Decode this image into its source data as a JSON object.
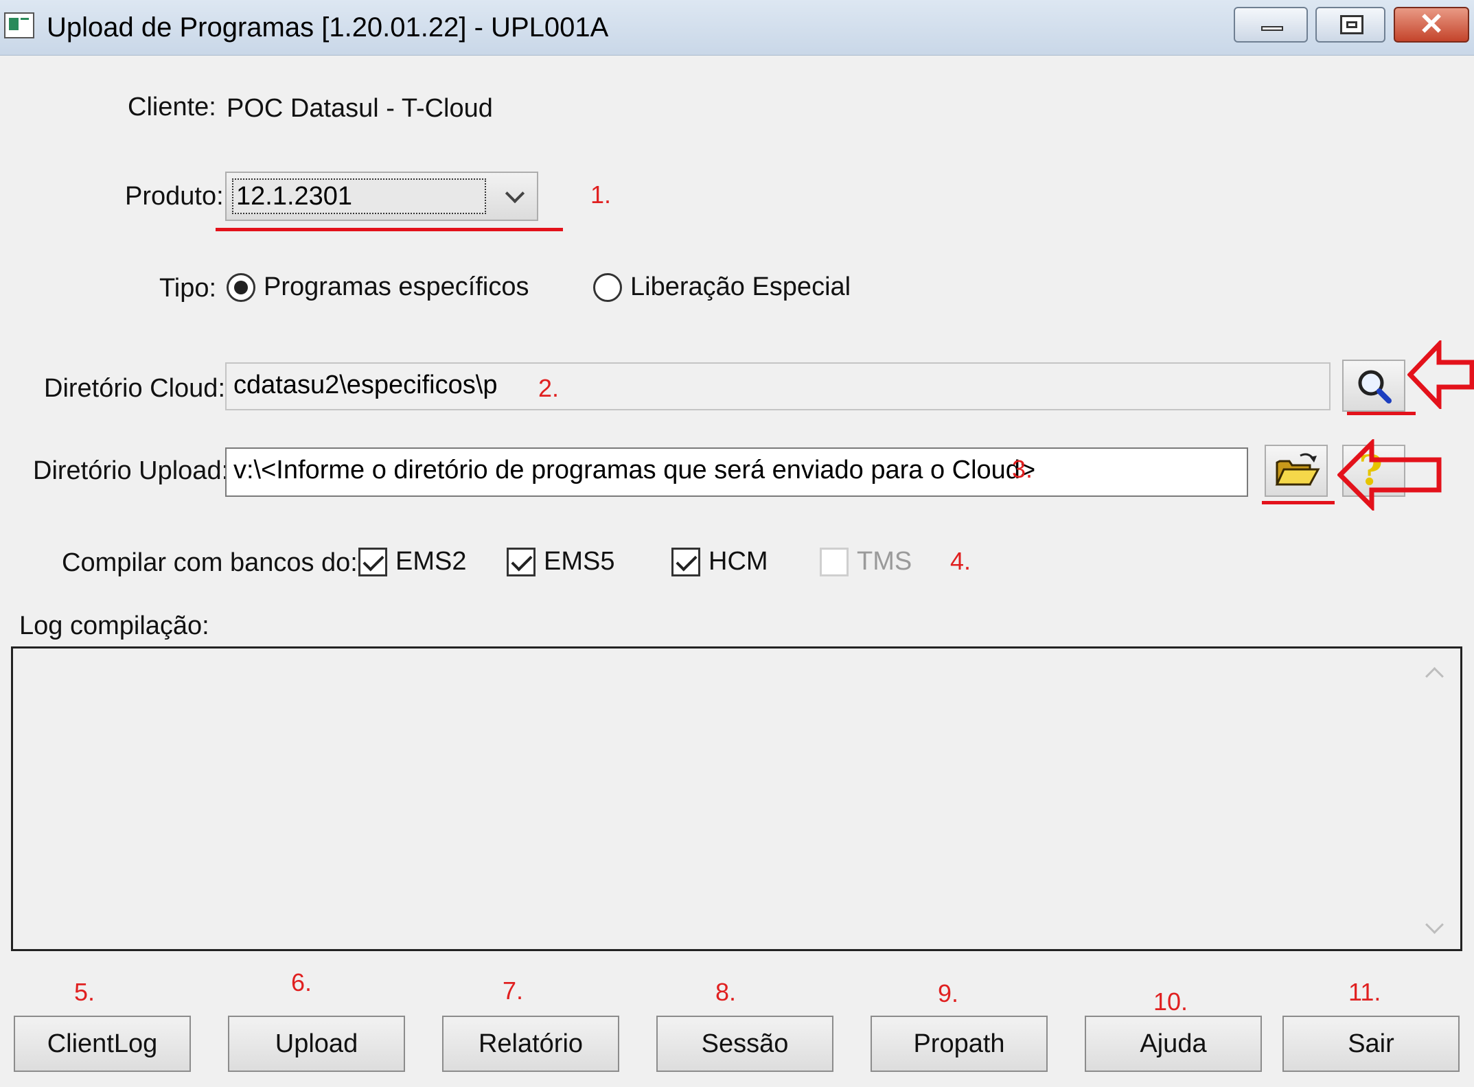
{
  "window": {
    "title": "Upload de Programas [1.20.01.22] - UPL001A",
    "close_glyph": "✕"
  },
  "cliente": {
    "label": "Cliente:",
    "value": "POC Datasul - T-Cloud"
  },
  "produto": {
    "label": "Produto:",
    "value": "12.1.2301",
    "marker": "1."
  },
  "tipo": {
    "label": "Tipo:",
    "options": [
      {
        "label": "Programas específicos",
        "selected": true
      },
      {
        "label": "Liberação Especial",
        "selected": false
      }
    ]
  },
  "diretorio_cloud": {
    "label": "Diretório Cloud:",
    "value": "cdatasu2\\especificos\\p",
    "marker": "2."
  },
  "diretorio_upload": {
    "label": "Diretório Upload:",
    "value": "v:\\<Informe o diretório de programas que será enviado para o Cloud>",
    "marker": "3.",
    "help_glyph": "?"
  },
  "compilar": {
    "label": "Compilar com bancos do:",
    "marker": "4.",
    "options": [
      {
        "label": "EMS2",
        "checked": true,
        "enabled": true
      },
      {
        "label": "EMS5",
        "checked": true,
        "enabled": true
      },
      {
        "label": "HCM",
        "checked": true,
        "enabled": true
      },
      {
        "label": "TMS",
        "checked": false,
        "enabled": false
      }
    ]
  },
  "log": {
    "label": "Log compilação:"
  },
  "buttons": [
    {
      "label": "ClientLog",
      "marker": "5."
    },
    {
      "label": "Upload",
      "marker": "6."
    },
    {
      "label": "Relatório",
      "marker": "7."
    },
    {
      "label": "Sessão",
      "marker": "8."
    },
    {
      "label": "Propath",
      "marker": "9."
    },
    {
      "label": "Ajuda",
      "marker": "10."
    },
    {
      "label": "Sair",
      "marker": "11."
    }
  ],
  "colors": {
    "annotation": "#e02020",
    "titlebar": "#c9d7e8",
    "background": "#f0f0f0"
  }
}
